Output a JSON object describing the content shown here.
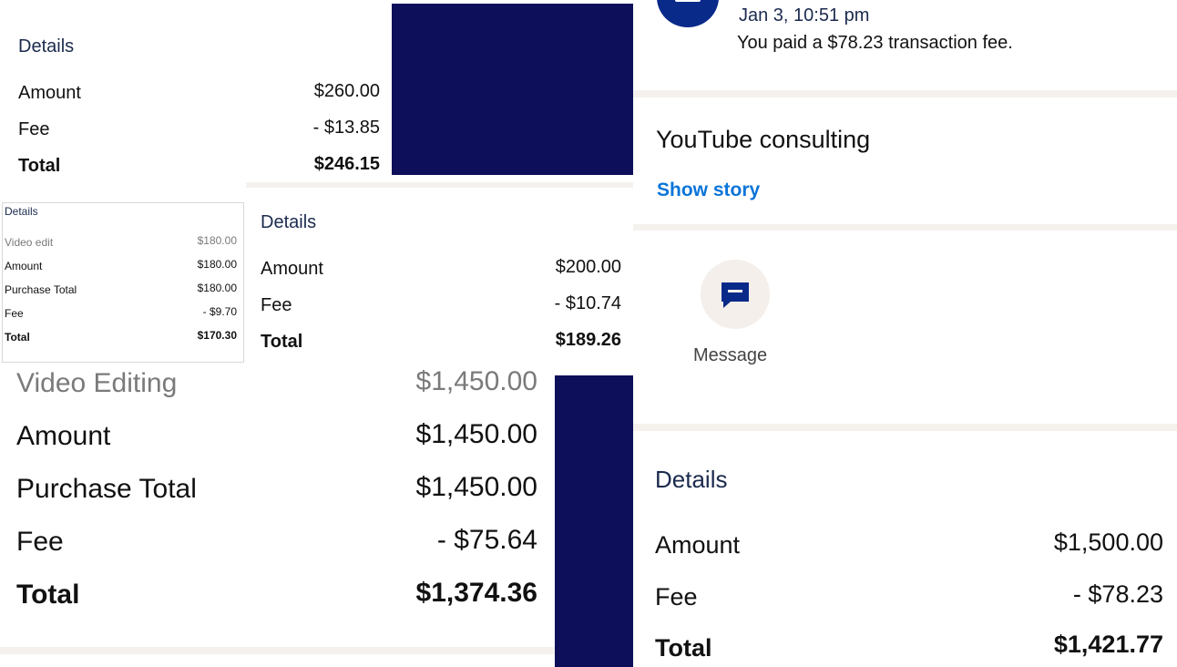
{
  "panel_a": {
    "heading": "Details",
    "rows": [
      {
        "label": "Amount",
        "value": "$260.00"
      },
      {
        "label": "Fee",
        "value": "- $13.85"
      },
      {
        "label": "Total",
        "value": "$246.15"
      }
    ]
  },
  "panel_b": {
    "heading": "Details",
    "rows": [
      {
        "label": "Video edit",
        "value": "$180.00"
      },
      {
        "label": "Amount",
        "value": "$180.00"
      },
      {
        "label": "Purchase Total",
        "value": "$180.00"
      },
      {
        "label": "Fee",
        "value": "- $9.70"
      },
      {
        "label": "Total",
        "value": "$170.30"
      }
    ]
  },
  "panel_c": {
    "heading": "Details",
    "rows": [
      {
        "label": "Amount",
        "value": "$200.00"
      },
      {
        "label": "Fee",
        "value": "- $10.74"
      },
      {
        "label": "Total",
        "value": "$189.26"
      }
    ]
  },
  "panel_d": {
    "rows": [
      {
        "label": "Video Editing",
        "value": "$1,450.00"
      },
      {
        "label": "Amount",
        "value": "$1,450.00"
      },
      {
        "label": "Purchase Total",
        "value": "$1,450.00"
      },
      {
        "label": "Fee",
        "value": "- $75.64"
      },
      {
        "label": "Total",
        "value": "$1,374.36"
      }
    ]
  },
  "panel_e": {
    "activity": {
      "timestamp": "Jan 3, 10:51 pm",
      "text": "You paid a $78.23 transaction fee."
    },
    "note": {
      "title": "YouTube consulting",
      "link": "Show story"
    },
    "message_label": "Message",
    "heading": "Details",
    "rows": [
      {
        "label": "Amount",
        "value": "$1,500.00"
      },
      {
        "label": "Fee",
        "value": "- $78.23"
      },
      {
        "label": "Total",
        "value": "$1,421.77"
      }
    ]
  },
  "colors": {
    "navy_block": "#0d0f5a",
    "heading": "#1b2a4e",
    "link": "#0a74d9",
    "icon_circle_bg": "#f4efea",
    "icon": "#0a2a8a",
    "separator": "#f5f2ee"
  },
  "icons": [
    "activity-avatar-icon",
    "chat-bubble-icon"
  ]
}
